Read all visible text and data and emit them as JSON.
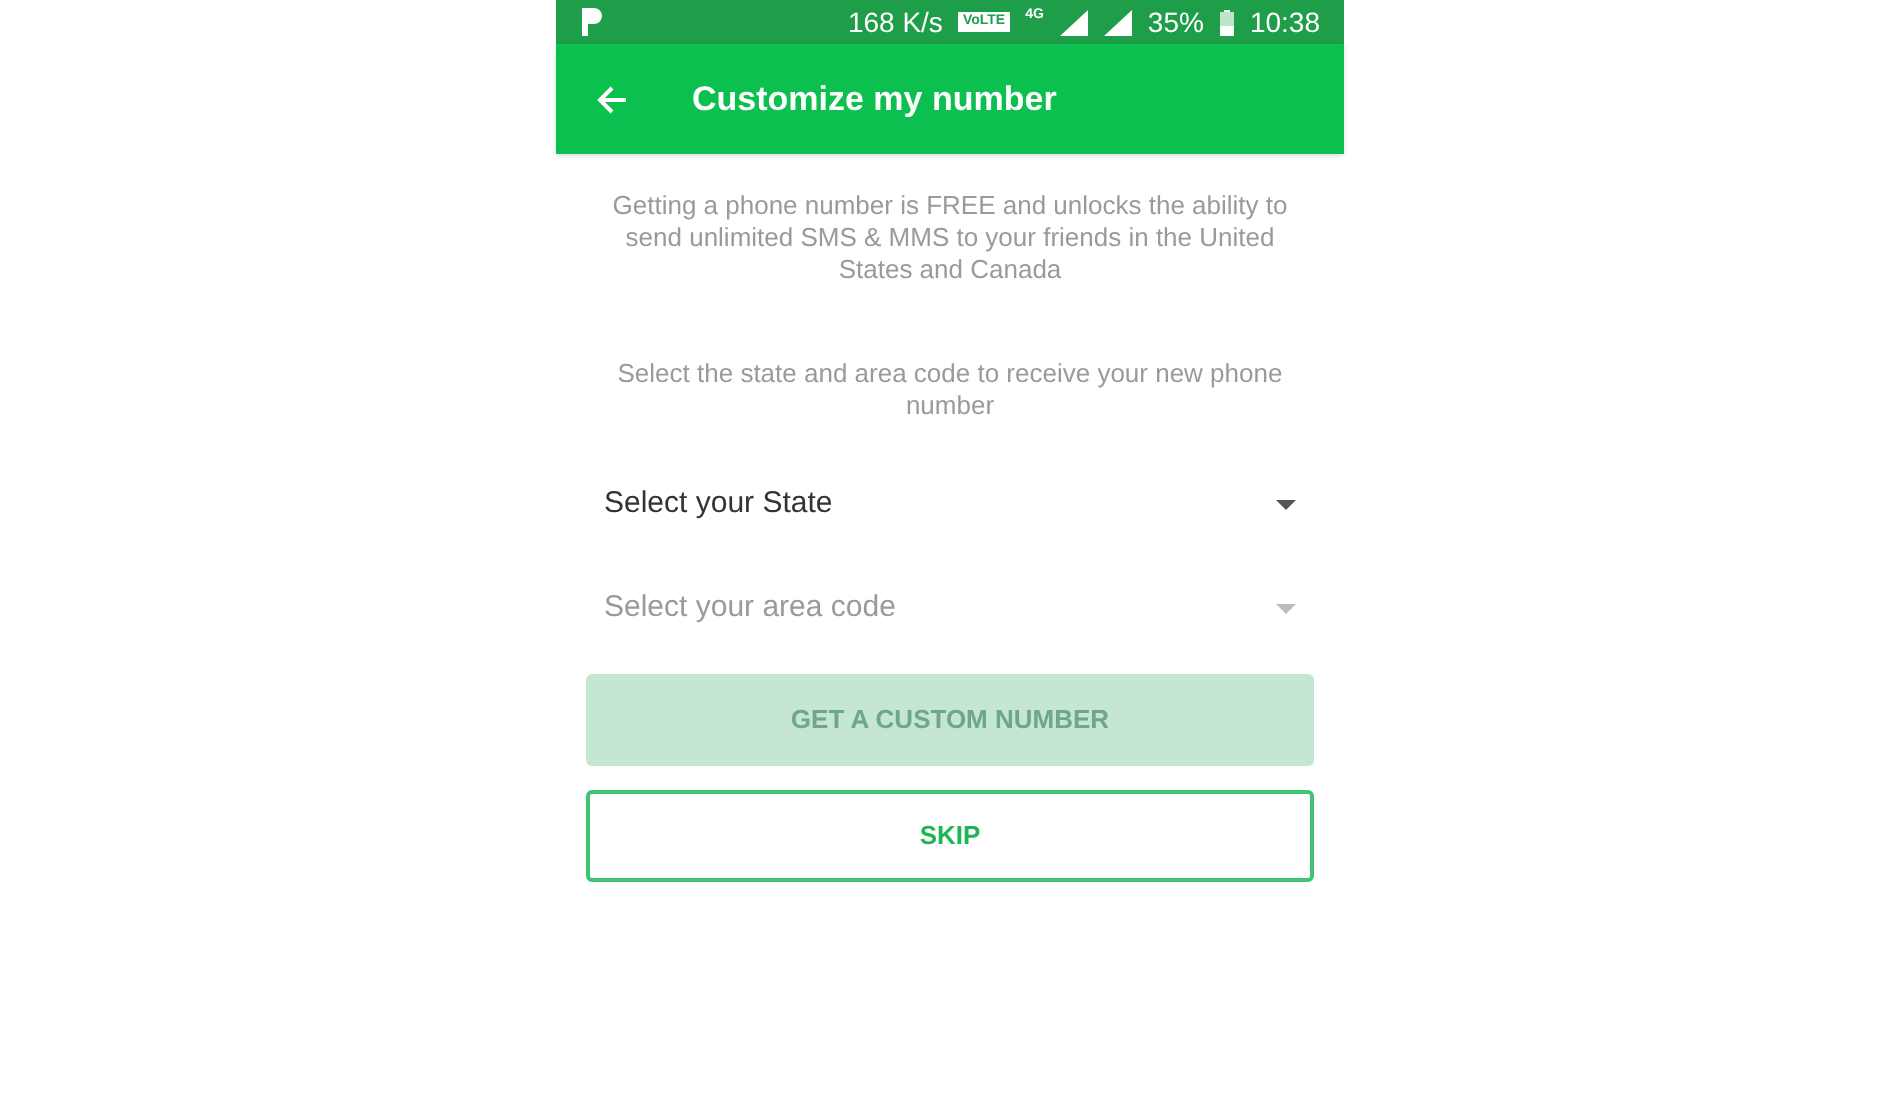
{
  "status_bar": {
    "speed": "168 K/s",
    "volte": "VoLTE",
    "network": "4G",
    "battery": "35%",
    "time": "10:38"
  },
  "app_bar": {
    "title": "Customize my number"
  },
  "intro": "Getting a phone number is FREE and unlocks the ability to send unlimited SMS & MMS to your friends in the United States and Canada",
  "instruction": "Select the state and area code to receive your new phone number",
  "dropdowns": [
    {
      "placeholder": "Select your State",
      "disabled": false
    },
    {
      "placeholder": "Select your area code",
      "disabled": true
    }
  ],
  "buttons": [
    {
      "label": "GET A CUSTOM NUMBER",
      "kind": "filled",
      "disabled": true
    },
    {
      "label": "SKIP",
      "kind": "outline",
      "disabled": false
    }
  ]
}
